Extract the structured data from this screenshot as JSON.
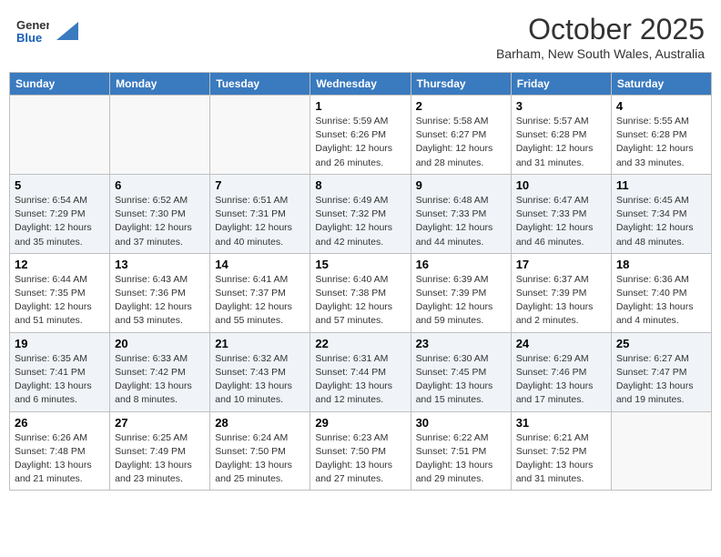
{
  "header": {
    "logo_general": "General",
    "logo_blue": "Blue",
    "month_title": "October 2025",
    "location": "Barham, New South Wales, Australia"
  },
  "days_of_week": [
    "Sunday",
    "Monday",
    "Tuesday",
    "Wednesday",
    "Thursday",
    "Friday",
    "Saturday"
  ],
  "weeks": [
    [
      {
        "day": "",
        "info": ""
      },
      {
        "day": "",
        "info": ""
      },
      {
        "day": "",
        "info": ""
      },
      {
        "day": "1",
        "info": "Sunrise: 5:59 AM\nSunset: 6:26 PM\nDaylight: 12 hours\nand 26 minutes."
      },
      {
        "day": "2",
        "info": "Sunrise: 5:58 AM\nSunset: 6:27 PM\nDaylight: 12 hours\nand 28 minutes."
      },
      {
        "day": "3",
        "info": "Sunrise: 5:57 AM\nSunset: 6:28 PM\nDaylight: 12 hours\nand 31 minutes."
      },
      {
        "day": "4",
        "info": "Sunrise: 5:55 AM\nSunset: 6:28 PM\nDaylight: 12 hours\nand 33 minutes."
      }
    ],
    [
      {
        "day": "5",
        "info": "Sunrise: 6:54 AM\nSunset: 7:29 PM\nDaylight: 12 hours\nand 35 minutes."
      },
      {
        "day": "6",
        "info": "Sunrise: 6:52 AM\nSunset: 7:30 PM\nDaylight: 12 hours\nand 37 minutes."
      },
      {
        "day": "7",
        "info": "Sunrise: 6:51 AM\nSunset: 7:31 PM\nDaylight: 12 hours\nand 40 minutes."
      },
      {
        "day": "8",
        "info": "Sunrise: 6:49 AM\nSunset: 7:32 PM\nDaylight: 12 hours\nand 42 minutes."
      },
      {
        "day": "9",
        "info": "Sunrise: 6:48 AM\nSunset: 7:33 PM\nDaylight: 12 hours\nand 44 minutes."
      },
      {
        "day": "10",
        "info": "Sunrise: 6:47 AM\nSunset: 7:33 PM\nDaylight: 12 hours\nand 46 minutes."
      },
      {
        "day": "11",
        "info": "Sunrise: 6:45 AM\nSunset: 7:34 PM\nDaylight: 12 hours\nand 48 minutes."
      }
    ],
    [
      {
        "day": "12",
        "info": "Sunrise: 6:44 AM\nSunset: 7:35 PM\nDaylight: 12 hours\nand 51 minutes."
      },
      {
        "day": "13",
        "info": "Sunrise: 6:43 AM\nSunset: 7:36 PM\nDaylight: 12 hours\nand 53 minutes."
      },
      {
        "day": "14",
        "info": "Sunrise: 6:41 AM\nSunset: 7:37 PM\nDaylight: 12 hours\nand 55 minutes."
      },
      {
        "day": "15",
        "info": "Sunrise: 6:40 AM\nSunset: 7:38 PM\nDaylight: 12 hours\nand 57 minutes."
      },
      {
        "day": "16",
        "info": "Sunrise: 6:39 AM\nSunset: 7:39 PM\nDaylight: 12 hours\nand 59 minutes."
      },
      {
        "day": "17",
        "info": "Sunrise: 6:37 AM\nSunset: 7:39 PM\nDaylight: 13 hours\nand 2 minutes."
      },
      {
        "day": "18",
        "info": "Sunrise: 6:36 AM\nSunset: 7:40 PM\nDaylight: 13 hours\nand 4 minutes."
      }
    ],
    [
      {
        "day": "19",
        "info": "Sunrise: 6:35 AM\nSunset: 7:41 PM\nDaylight: 13 hours\nand 6 minutes."
      },
      {
        "day": "20",
        "info": "Sunrise: 6:33 AM\nSunset: 7:42 PM\nDaylight: 13 hours\nand 8 minutes."
      },
      {
        "day": "21",
        "info": "Sunrise: 6:32 AM\nSunset: 7:43 PM\nDaylight: 13 hours\nand 10 minutes."
      },
      {
        "day": "22",
        "info": "Sunrise: 6:31 AM\nSunset: 7:44 PM\nDaylight: 13 hours\nand 12 minutes."
      },
      {
        "day": "23",
        "info": "Sunrise: 6:30 AM\nSunset: 7:45 PM\nDaylight: 13 hours\nand 15 minutes."
      },
      {
        "day": "24",
        "info": "Sunrise: 6:29 AM\nSunset: 7:46 PM\nDaylight: 13 hours\nand 17 minutes."
      },
      {
        "day": "25",
        "info": "Sunrise: 6:27 AM\nSunset: 7:47 PM\nDaylight: 13 hours\nand 19 minutes."
      }
    ],
    [
      {
        "day": "26",
        "info": "Sunrise: 6:26 AM\nSunset: 7:48 PM\nDaylight: 13 hours\nand 21 minutes."
      },
      {
        "day": "27",
        "info": "Sunrise: 6:25 AM\nSunset: 7:49 PM\nDaylight: 13 hours\nand 23 minutes."
      },
      {
        "day": "28",
        "info": "Sunrise: 6:24 AM\nSunset: 7:50 PM\nDaylight: 13 hours\nand 25 minutes."
      },
      {
        "day": "29",
        "info": "Sunrise: 6:23 AM\nSunset: 7:50 PM\nDaylight: 13 hours\nand 27 minutes."
      },
      {
        "day": "30",
        "info": "Sunrise: 6:22 AM\nSunset: 7:51 PM\nDaylight: 13 hours\nand 29 minutes."
      },
      {
        "day": "31",
        "info": "Sunrise: 6:21 AM\nSunset: 7:52 PM\nDaylight: 13 hours\nand 31 minutes."
      },
      {
        "day": "",
        "info": ""
      }
    ]
  ]
}
